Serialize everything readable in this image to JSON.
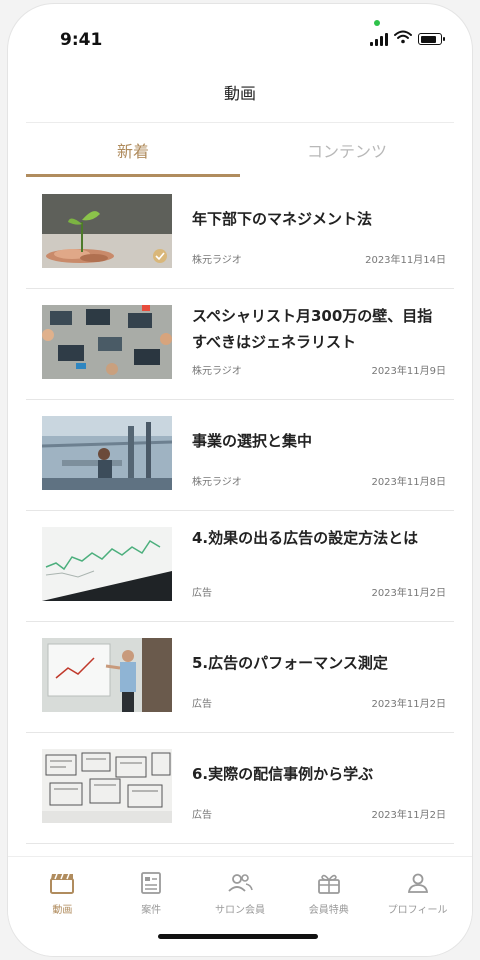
{
  "status_bar": {
    "time": "9:41",
    "dot_color": "#2ec24a",
    "battery_level": 0.95
  },
  "header": {
    "title": "動画"
  },
  "tabs": [
    {
      "label": "新着",
      "active": true
    },
    {
      "label": "コンテンツ",
      "active": false
    }
  ],
  "videos": [
    {
      "title": "年下部下のマネジメント法",
      "source": "株元ラジオ",
      "date": "2023年11月14日",
      "thumbnail": "plant-coins"
    },
    {
      "title": "スペシャリスト月300万の壁、目指すべきはジェネラリスト",
      "source": "株元ラジオ",
      "date": "2023年11月9日",
      "thumbnail": "laptops-desk"
    },
    {
      "title": "事業の選択と集中",
      "source": "株元ラジオ",
      "date": "2023年11月8日",
      "thumbnail": "factory-worker"
    },
    {
      "title": "4.効果の出る広告の設定方法とは",
      "source": "広告",
      "date": "2023年11月2日",
      "thumbnail": "line-chart-screen"
    },
    {
      "title": "5.広告のパフォーマンス測定",
      "source": "広告",
      "date": "2023年11月2日",
      "thumbnail": "presenter-whiteboard"
    },
    {
      "title": "6.実際の配信事例から学ぶ",
      "source": "広告",
      "date": "2023年11月2日",
      "thumbnail": "wireframe-sketches"
    }
  ],
  "tab_bar": [
    {
      "label": "動画",
      "icon": "clapperboard-icon",
      "active": true
    },
    {
      "label": "案件",
      "icon": "document-list-icon",
      "active": false
    },
    {
      "label": "サロン会員",
      "icon": "users-icon",
      "active": false
    },
    {
      "label": "会員特典",
      "icon": "gift-icon",
      "active": false
    },
    {
      "label": "プロフィール",
      "icon": "person-icon",
      "active": false
    }
  ],
  "colors": {
    "accent": "#b08c5e",
    "inactive": "#9a9a9a",
    "inactive_tab": "#b8b8b8",
    "text": "#222222"
  }
}
